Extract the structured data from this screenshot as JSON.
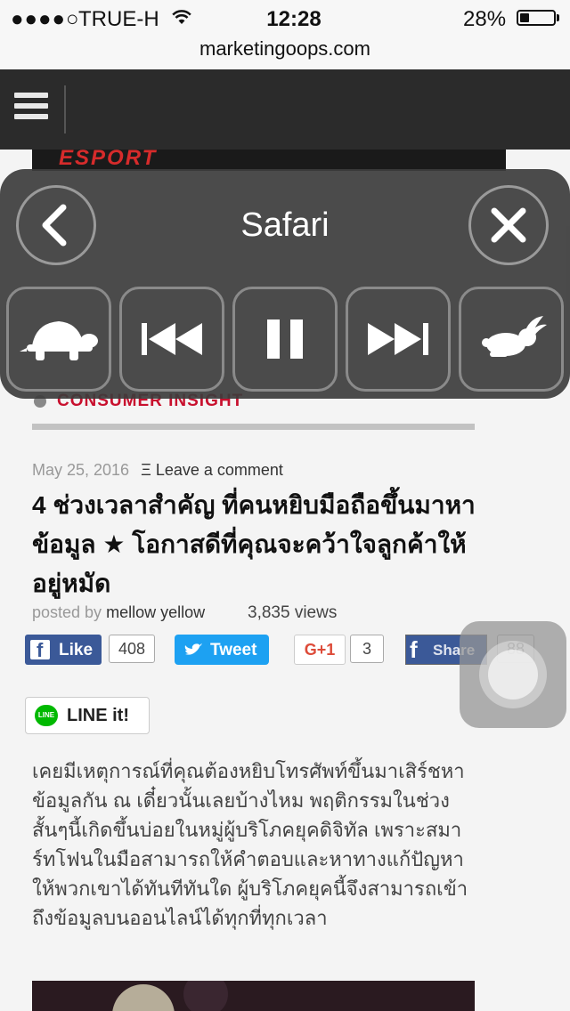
{
  "status_bar": {
    "signal": "●●●●○",
    "carrier": "TRUE-H",
    "time": "12:28",
    "battery_pct_text": "28%",
    "battery_level": 0.28
  },
  "browser": {
    "url": "marketingoops.com"
  },
  "assistive_panel": {
    "title": "Safari",
    "back_icon": "chevron-left-icon",
    "close_icon": "close-icon",
    "controls": [
      "turtle-icon",
      "rewind-icon",
      "pause-icon",
      "fast-forward-icon",
      "rabbit-icon"
    ]
  },
  "article": {
    "category": "CONSUMER INSIGHT",
    "date": "May 25, 2016",
    "comment_marker": "Ξ",
    "comment_link": "Leave a comment",
    "title": "4 ช่วงเวลาสำคัญ ที่คนหยิบมือถือขึ้นมาหาข้อมูล ★ โอกาสดีที่คุณจะคว้าใจลูกค้าให้อยู่หมัด",
    "posted_by_label": "posted by",
    "author": "mellow yellow",
    "views": "3,835 views",
    "body": "เคยมีเหตุการณ์ที่คุณต้องหยิบโทรศัพท์ขึ้นมาเสิร์ชหาข้อมูลกัน ณ เดี๋ยวนั้นเลยบ้างไหม พฤติกรรมในช่วงสั้นๆนี้เกิดขึ้นบ่อยในหมู่ผู้บริโภคยุคดิจิทัล เพราะสมาร์ทโฟนในมือสามารถให้คำตอบและหาทางแก้ปัญหาให้พวกเขาได้ทันทีทันใด ผู้บริโภคยุคนี้จึงสามารถเข้าถึงข้อมูลบนออนไลน์ได้ทุกที่ทุกเวลา"
  },
  "social": {
    "like_label": "Like",
    "like_count": "408",
    "tweet_label": "Tweet",
    "gplus_label": "G+1",
    "gplus_count": "3",
    "share_label": "Share",
    "share_count": "88",
    "line_label": "LINE it!",
    "line_badge": "LINE"
  },
  "colors": {
    "facebook": "#3b5998",
    "twitter": "#1da1f2",
    "google_plus": "#dd4b39",
    "line": "#00b900",
    "category_red": "#c8102e"
  }
}
